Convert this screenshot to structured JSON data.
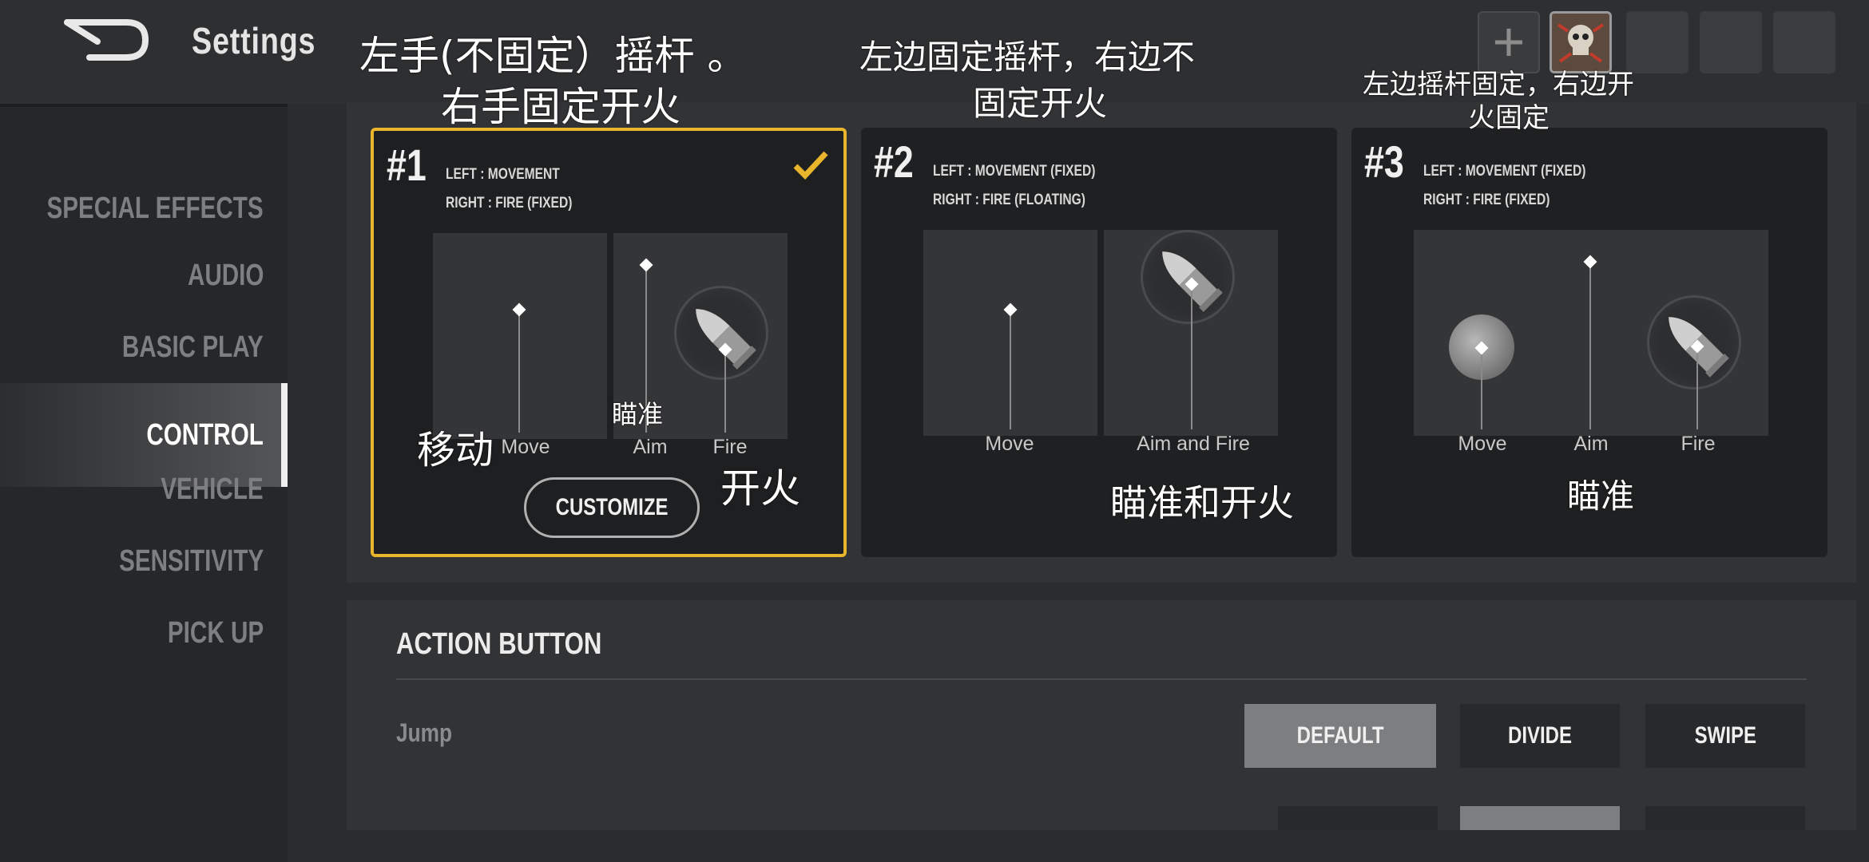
{
  "header": {
    "title": "Settings",
    "add_symbol": "+"
  },
  "sidebar": {
    "items": [
      {
        "label": "SPECIAL EFFECTS"
      },
      {
        "label": "AUDIO"
      },
      {
        "label": "BASIC PLAY"
      },
      {
        "label": "CONTROL",
        "active": true
      },
      {
        "label": "VEHICLE"
      },
      {
        "label": "SENSITIVITY"
      },
      {
        "label": "PICK UP"
      }
    ]
  },
  "layouts": [
    {
      "number": "#1",
      "left_desc": "LEFT : MOVEMENT",
      "right_desc": "RIGHT : FIRE (FIXED)",
      "selected": true,
      "labels": {
        "move": "Move",
        "aim": "Aim",
        "fire": "Fire"
      },
      "customize_label": "CUSTOMIZE"
    },
    {
      "number": "#2",
      "left_desc": "LEFT : MOVEMENT (FIXED)",
      "right_desc": "RIGHT : FIRE (FLOATING)",
      "selected": false,
      "labels": {
        "move": "Move",
        "aim_fire": "Aim and Fire"
      }
    },
    {
      "number": "#3",
      "left_desc": "LEFT : MOVEMENT (FIXED)",
      "right_desc": "RIGHT : FIRE (FIXED)",
      "selected": false,
      "labels": {
        "move": "Move",
        "aim": "Aim",
        "fire": "Fire"
      }
    }
  ],
  "action_button": {
    "title": "ACTION BUTTON",
    "jump_label": "Jump",
    "options": [
      "DEFAULT",
      "DIVIDE",
      "SWIPE"
    ],
    "selected": "DEFAULT"
  },
  "annotations": {
    "a1_line1": "左手(不固定）摇杆 。",
    "a1_line2": "右手固定开火",
    "a2_line1": "左边固定摇杆，右边不",
    "a2_line2": "固定开火",
    "a3_line1": "左边摇杆固定，右边开",
    "a3_line2": "火固定",
    "move_cn": "移动",
    "aim_cn": "瞄准",
    "fire_cn": "开火",
    "aim_fire_cn": "瞄准和开火",
    "aim_cn_3": "瞄准"
  },
  "colors": {
    "accent": "#e9b52c",
    "background": "#2b2c2e",
    "panel": "#323335",
    "selected_option": "#7d7e80"
  },
  "icons": {
    "back": "back-arrow-icon",
    "check": "checkmark-icon",
    "fire": "bullet-icon",
    "add": "plus-icon"
  }
}
